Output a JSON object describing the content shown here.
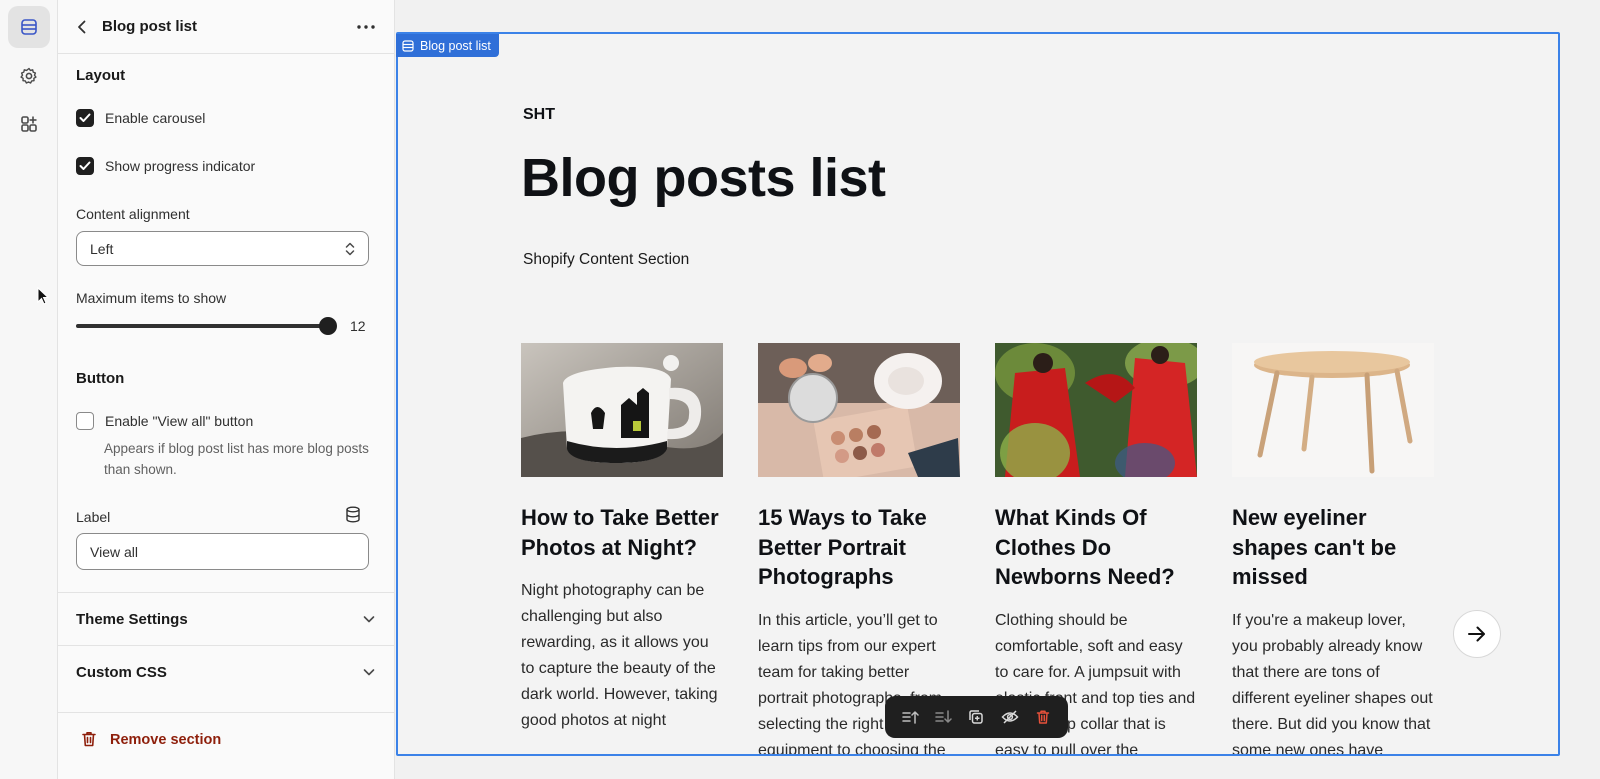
{
  "panel": {
    "title": "Blog post list",
    "layout_heading": "Layout",
    "enable_carousel": {
      "label": "Enable carousel",
      "checked": true
    },
    "show_progress": {
      "label": "Show progress indicator",
      "checked": true
    },
    "alignment": {
      "label": "Content alignment",
      "value": "Left"
    },
    "max_items": {
      "label": "Maximum items to show",
      "value": "12",
      "fraction": 1.0
    },
    "button_heading": "Button",
    "view_all": {
      "label": "Enable \"View all\" button",
      "checked": false,
      "help": "Appears if blog post list has more blog posts than shown."
    },
    "label_field": {
      "label": "Label",
      "value": "View all"
    },
    "theme_settings": "Theme Settings",
    "custom_css": "Custom CSS",
    "remove": "Remove section"
  },
  "preview": {
    "tag": "Blog post list",
    "subheading": "SHT",
    "title": "Blog posts list",
    "description": "Shopify Content Section",
    "cards": [
      {
        "title": "How to Take Better Photos at Night?",
        "text": "Night photography can be challenging but also rewarding, as it allows you to capture the beauty of the dark world. However, taking good photos at night"
      },
      {
        "title": "15 Ways to Take Better Portrait Photographs",
        "text": "In this article, you’ll get to learn tips from our expert team for taking better portrait photographs, from selecting the right equipment to choosing the"
      },
      {
        "title": "What Kinds Of Clothes Do Newborns Need?",
        "text": "Clothing should be comfortable, soft and easy to care for. A jumpsuit with elastic front and top ties and a button-up collar that is easy to pull over the"
      },
      {
        "title": "New eyeliner shapes can't be missed",
        "text": "If you're a makeup lover, you probably already know that there are tons of different eyeliner shapes out there. But did you know that some new ones have"
      }
    ]
  },
  "colors": {
    "accent": "#3b82e8",
    "danger": "#8e1f0b",
    "dark": "#1f1f1f"
  },
  "icons": [
    "sections-icon",
    "gear-icon",
    "apps-icon",
    "back-icon",
    "more-icon",
    "chevron-updown-icon",
    "database-icon",
    "chevron-down-icon",
    "trash-icon",
    "arrow-right-icon",
    "move-up-icon",
    "move-down-icon",
    "duplicate-icon",
    "hide-icon",
    "delete-icon"
  ]
}
